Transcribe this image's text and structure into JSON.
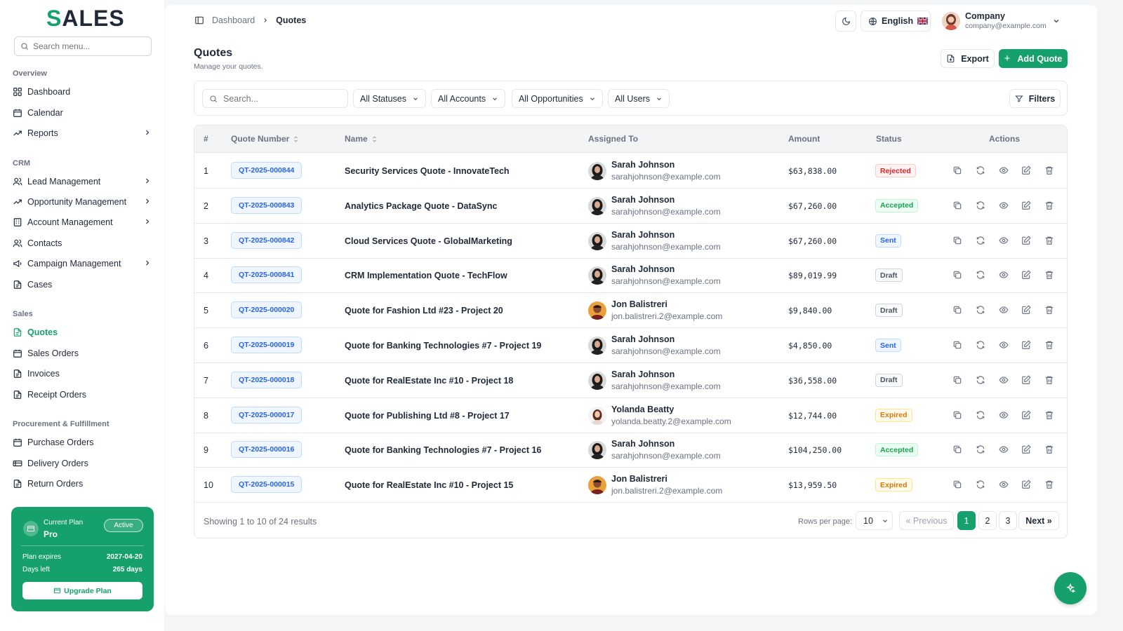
{
  "brand": {
    "logo_s": "S",
    "logo_rest": "ALES",
    "accent": "#16a06b"
  },
  "sidebar": {
    "search_placeholder": "Search menu...",
    "sections": [
      {
        "title": "Overview"
      },
      {
        "title": "CRM"
      },
      {
        "title": "Sales"
      },
      {
        "title": "Procurement & Fulfillment"
      }
    ],
    "items": [
      {
        "label": "Dashboard",
        "icon": "grid-icon"
      },
      {
        "label": "Calendar",
        "icon": "calendar-icon"
      },
      {
        "label": "Reports",
        "icon": "trending-icon",
        "has_children": true
      },
      {
        "label": "Lead Management",
        "icon": "users-icon",
        "has_children": true
      },
      {
        "label": "Opportunity Management",
        "icon": "trending-icon",
        "has_children": true
      },
      {
        "label": "Account Management",
        "icon": "building-icon",
        "has_children": true
      },
      {
        "label": "Contacts",
        "icon": "users-icon"
      },
      {
        "label": "Campaign Management",
        "icon": "megaphone-icon",
        "has_children": true
      },
      {
        "label": "Cases",
        "icon": "document-icon"
      },
      {
        "label": "Quotes",
        "icon": "document-icon",
        "active": true
      },
      {
        "label": "Sales Orders",
        "icon": "calendar-icon"
      },
      {
        "label": "Invoices",
        "icon": "document-icon"
      },
      {
        "label": "Receipt Orders",
        "icon": "document-icon"
      },
      {
        "label": "Purchase Orders",
        "icon": "calendar-icon"
      },
      {
        "label": "Delivery Orders",
        "icon": "truck-icon"
      },
      {
        "label": "Return Orders",
        "icon": "document-icon"
      }
    ],
    "plan": {
      "label": "Current Plan",
      "name": "Pro",
      "badge": "Active",
      "expires_label": "Plan expires",
      "expires_value": "2027-04-20",
      "days_label": "Days left",
      "days_value": "265 days",
      "upgrade_label": "Upgrade Plan"
    }
  },
  "header": {
    "breadcrumb_root": "Dashboard",
    "breadcrumb_current": "Quotes",
    "language": "English",
    "user_name": "Company",
    "user_email": "company@example.com"
  },
  "page": {
    "title": "Quotes",
    "subtitle": "Manage your quotes.",
    "export_label": "Export",
    "add_label": "Add Quote"
  },
  "filters": {
    "search_placeholder": "Search...",
    "statuses": "All Statuses",
    "accounts": "All Accounts",
    "opportunities": "All Opportunities",
    "users": "All Users",
    "filters_label": "Filters"
  },
  "table": {
    "headers": {
      "num": "#",
      "quote_number": "Quote Number",
      "name": "Name",
      "assigned": "Assigned To",
      "amount": "Amount",
      "status": "Status",
      "actions": "Actions"
    },
    "rows": [
      {
        "num": "1",
        "quote_number": "QT-2025-000844",
        "name": "Security Services Quote - InnovateTech",
        "user": "Sarah Johnson",
        "email": "sarahjohnson@example.com",
        "amount": "$63,838.00",
        "status": "Rejected",
        "status_key": "rejected",
        "avatar": "sarah"
      },
      {
        "num": "2",
        "quote_number": "QT-2025-000843",
        "name": "Analytics Package Quote - DataSync",
        "user": "Sarah Johnson",
        "email": "sarahjohnson@example.com",
        "amount": "$67,260.00",
        "status": "Accepted",
        "status_key": "accepted",
        "avatar": "sarah"
      },
      {
        "num": "3",
        "quote_number": "QT-2025-000842",
        "name": "Cloud Services Quote - GlobalMarketing",
        "user": "Sarah Johnson",
        "email": "sarahjohnson@example.com",
        "amount": "$67,260.00",
        "status": "Sent",
        "status_key": "sent",
        "avatar": "sarah"
      },
      {
        "num": "4",
        "quote_number": "QT-2025-000841",
        "name": "CRM Implementation Quote - TechFlow",
        "user": "Sarah Johnson",
        "email": "sarahjohnson@example.com",
        "amount": "$89,019.99",
        "status": "Draft",
        "status_key": "draft",
        "avatar": "sarah"
      },
      {
        "num": "5",
        "quote_number": "QT-2025-000020",
        "name": "Quote for Fashion Ltd #23 - Project 20",
        "user": "Jon Balistreri",
        "email": "jon.balistreri.2@example.com",
        "amount": "$9,840.00",
        "status": "Draft",
        "status_key": "draft",
        "avatar": "jon"
      },
      {
        "num": "6",
        "quote_number": "QT-2025-000019",
        "name": "Quote for Banking Technologies #7 - Project 19",
        "user": "Sarah Johnson",
        "email": "sarahjohnson@example.com",
        "amount": "$4,850.00",
        "status": "Sent",
        "status_key": "sent",
        "avatar": "sarah"
      },
      {
        "num": "7",
        "quote_number": "QT-2025-000018",
        "name": "Quote for RealEstate Inc #10 - Project 18",
        "user": "Sarah Johnson",
        "email": "sarahjohnson@example.com",
        "amount": "$36,558.00",
        "status": "Draft",
        "status_key": "draft",
        "avatar": "sarah"
      },
      {
        "num": "8",
        "quote_number": "QT-2025-000017",
        "name": "Quote for Publishing Ltd #8 - Project 17",
        "user": "Yolanda Beatty",
        "email": "yolanda.beatty.2@example.com",
        "amount": "$12,744.00",
        "status": "Expired",
        "status_key": "expired",
        "avatar": "yolanda"
      },
      {
        "num": "9",
        "quote_number": "QT-2025-000016",
        "name": "Quote for Banking Technologies #7 - Project 16",
        "user": "Sarah Johnson",
        "email": "sarahjohnson@example.com",
        "amount": "$104,250.00",
        "status": "Accepted",
        "status_key": "accepted",
        "avatar": "sarah"
      },
      {
        "num": "10",
        "quote_number": "QT-2025-000015",
        "name": "Quote for RealEstate Inc #10 - Project 15",
        "user": "Jon Balistreri",
        "email": "jon.balistreri.2@example.com",
        "amount": "$13,959.50",
        "status": "Expired",
        "status_key": "expired",
        "avatar": "jon"
      }
    ]
  },
  "pagination": {
    "info": "Showing 1 to 10 of 24 results",
    "rows_label": "Rows per page:",
    "rows_value": "10",
    "prev": "« Previous",
    "pages": [
      "1",
      "2",
      "3"
    ],
    "current": "1",
    "next": "Next »"
  }
}
